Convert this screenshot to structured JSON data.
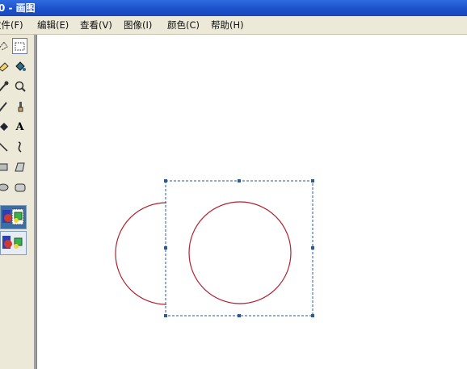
{
  "window": {
    "title": "0 - 画图"
  },
  "menu": [
    {
      "label": "文件(F)"
    },
    {
      "label": "编辑(E)"
    },
    {
      "label": "查看(V)"
    },
    {
      "label": "图像(I)"
    },
    {
      "label": "颜色(C)"
    },
    {
      "label": "帮助(H)"
    }
  ],
  "tools": {
    "left_column": [
      "free-select-icon",
      "eraser-icon",
      "color-picker-icon",
      "pencil-icon",
      "airbrush-icon",
      "line-icon",
      "rectangle-icon",
      "ellipse-icon"
    ],
    "right_column": [
      "rect-select-icon",
      "fill-bucket-icon",
      "magnifier-icon",
      "brush-icon",
      "text-icon",
      "curve-icon",
      "polygon-icon",
      "rounded-rect-icon"
    ],
    "text_tool_glyph": "A",
    "selected": "rect-select-icon"
  },
  "colors": {
    "titlebar": "#1a4fc9",
    "canvas": "#ffffff",
    "shape_stroke": "#b02030",
    "selection": "#2a5a9a"
  }
}
